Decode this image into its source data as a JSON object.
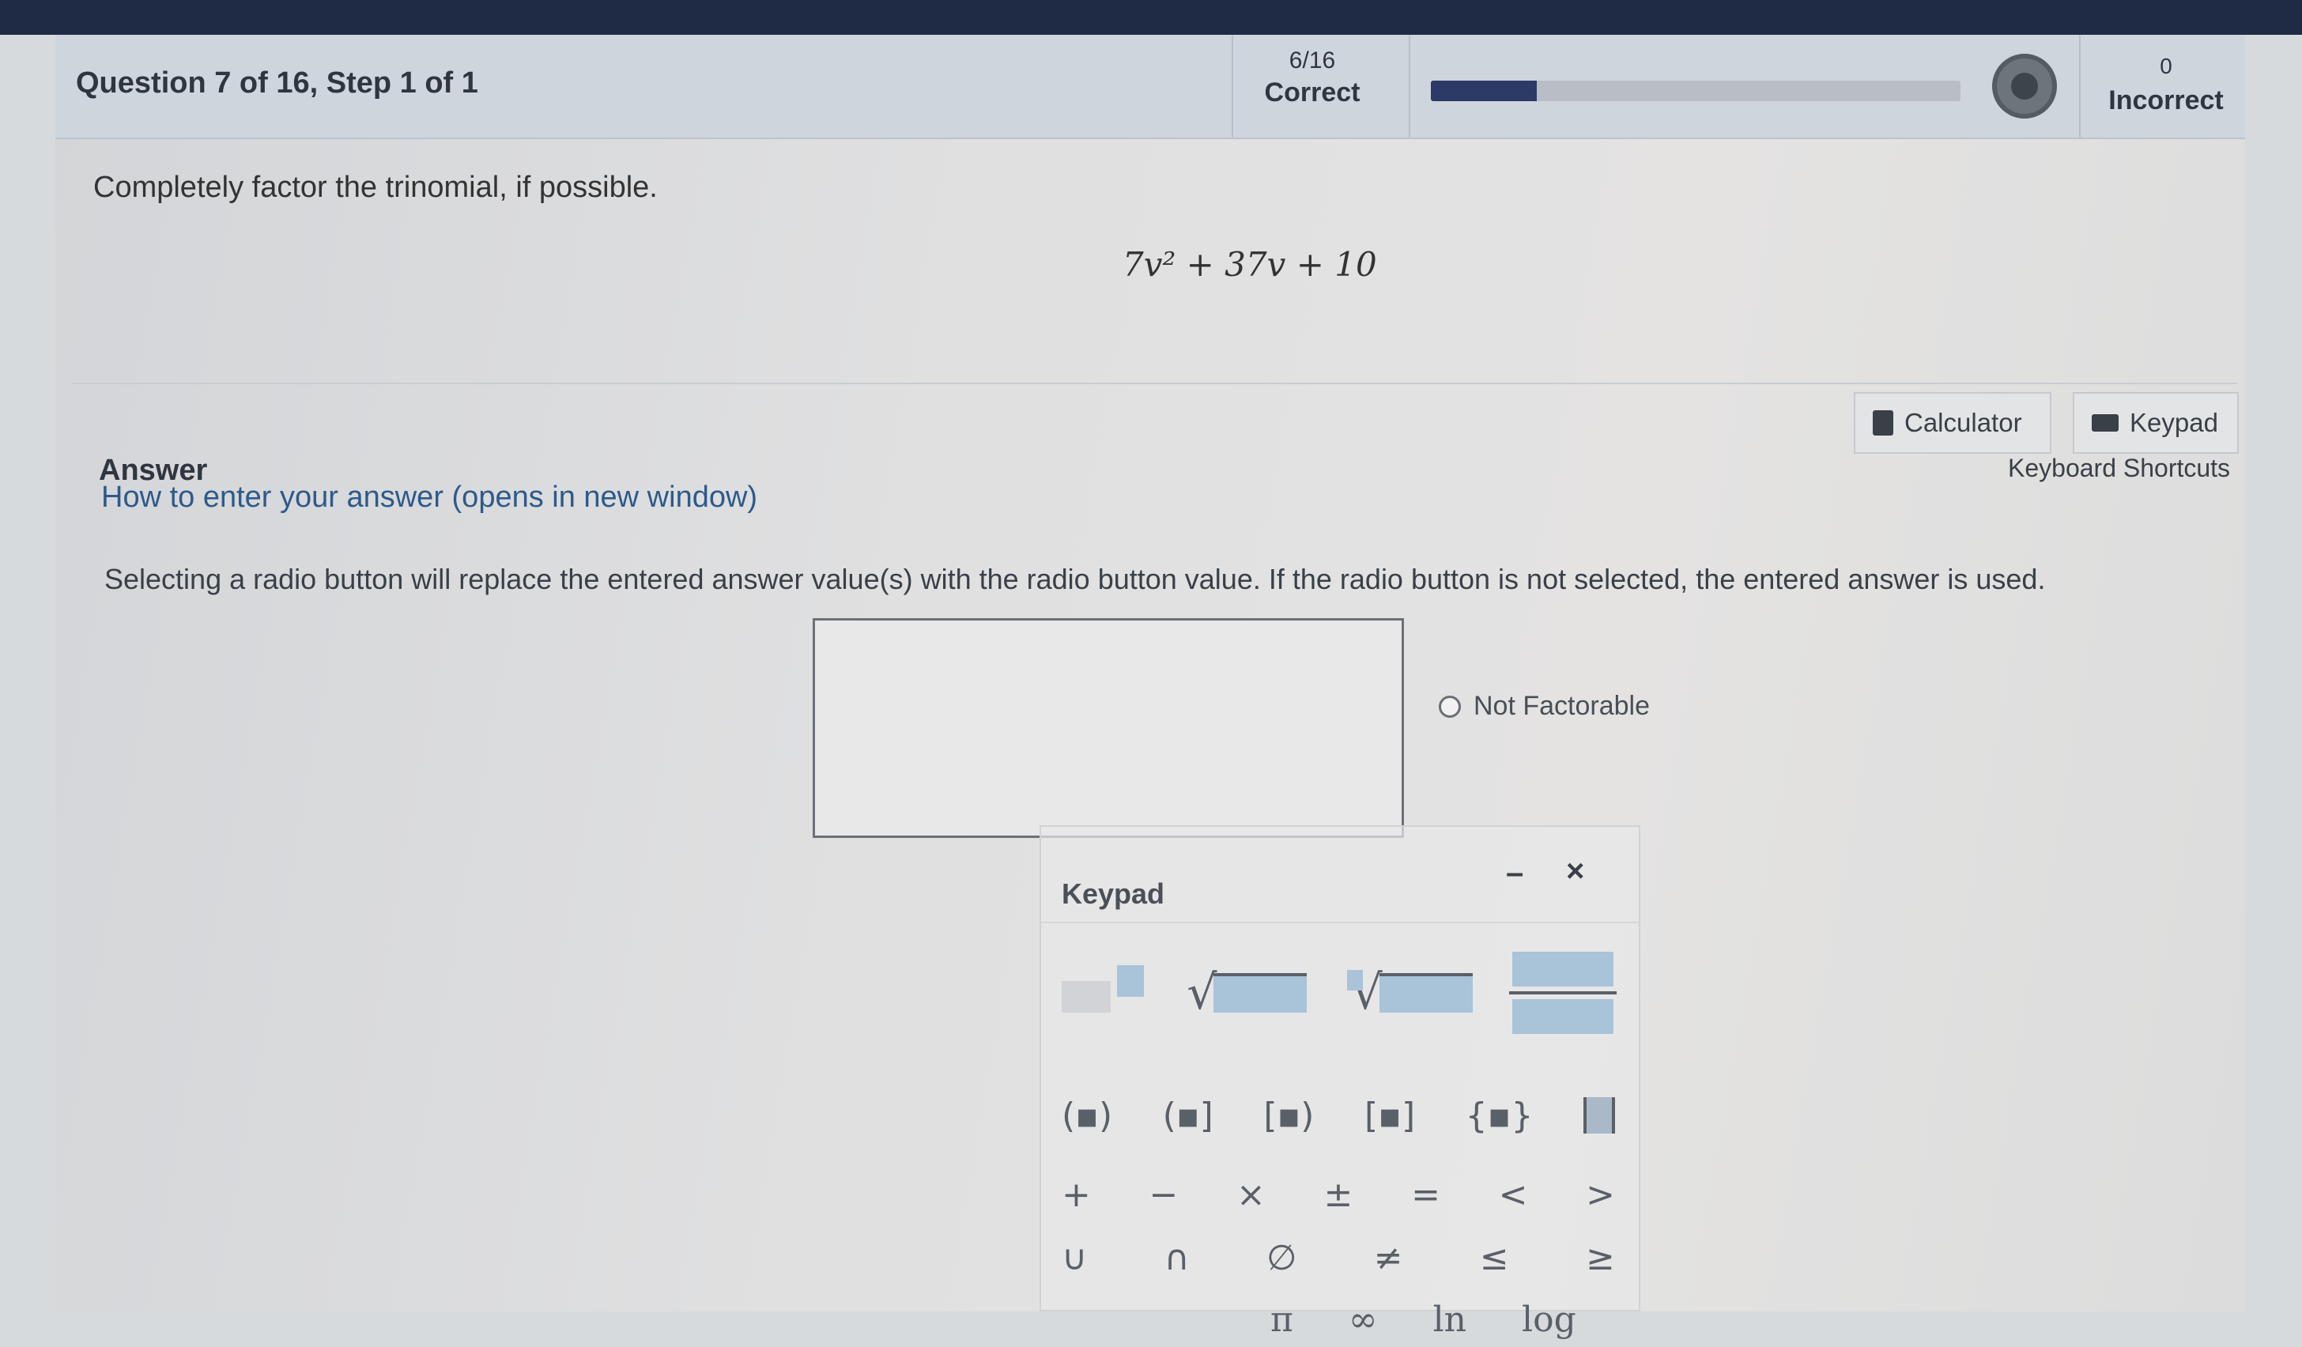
{
  "header": {
    "question_title": "Question 7 of 16,  Step 1 of 1",
    "correct_count": "6/16",
    "correct_label": "Correct",
    "progress_fraction": 0.2,
    "incorrect_count": "0",
    "incorrect_label": "Incorrect"
  },
  "question": {
    "prompt": "Completely factor the trinomial, if possible.",
    "expression": "7v² + 37v + 10"
  },
  "tools": {
    "calculator_label": "Calculator",
    "keypad_label": "Keypad",
    "shortcuts_label": "Keyboard Shortcuts"
  },
  "answer": {
    "label": "Answer",
    "howto_link": "How to enter your answer (opens in new window)",
    "instruction": "Selecting a radio button will replace the entered answer value(s) with the radio button value. If the radio button is not selected, the entered answer is used.",
    "input_value": "",
    "radio_label": "Not Factorable"
  },
  "keypad": {
    "title": "Keypad",
    "minimize": "–",
    "close": "×",
    "row2": [
      "(▪)",
      "(▪]",
      "[▪)",
      "[▪]",
      "{▪}"
    ],
    "row3": [
      "+",
      "−",
      "×",
      "±",
      "=",
      "<",
      ">"
    ],
    "row4": [
      "∪",
      "∩",
      "∅",
      "≠",
      "≤",
      "≥"
    ],
    "row5": [
      "π",
      "∞",
      "ln",
      "log"
    ]
  },
  "colors": {
    "topbar": "#1f2a44",
    "progress_fill": "#2b3a66",
    "link": "#2e5a8a",
    "input_box_fill": "#a9c3d8"
  }
}
